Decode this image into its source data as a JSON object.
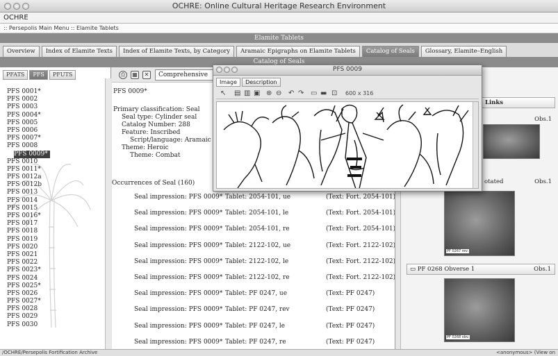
{
  "window": {
    "title": "OCHRE: Online Cultural Heritage Research Environment"
  },
  "menubar": {
    "label": "OCHRE"
  },
  "breadcrumb": ":: Persepolis Main Menu :: Elamite Tablets",
  "bands": {
    "section": "Elamite Tablets",
    "subsection": "Catalog of Seals"
  },
  "tabs": [
    {
      "label": "Overview"
    },
    {
      "label": "Index of Elamite Texts"
    },
    {
      "label": "Index of Elamite Texts, by Category"
    },
    {
      "label": "Aramaic Epigraphs on Elamite Tablets"
    },
    {
      "label": "Catalog of Seals"
    },
    {
      "label": "Glossary, Elamite–English"
    }
  ],
  "subtabs": [
    {
      "label": "PFATS"
    },
    {
      "label": "PFS"
    },
    {
      "label": "PFUTS"
    }
  ],
  "seals": [
    "PFS 0001*",
    "PFS 0002",
    "PFS 0003",
    "PFS 0004*",
    "PFS 0005",
    "PFS 0006",
    "PFS 0007*",
    "PFS 0008",
    "PFS 0009*",
    "PFS 0010",
    "PFS 0011*",
    "PFS 0012a",
    "PFS 0012b",
    "PFS 0013",
    "PFS 0014",
    "PFS 0015",
    "PFS 0016*",
    "PFS 0017",
    "PFS 0018",
    "PFS 0019",
    "PFS 0020",
    "PFS 0021",
    "PFS 0022",
    "PFS 0023*",
    "PFS 0024",
    "PFS 0025*",
    "PFS 0026",
    "PFS 0027*",
    "PFS 0028",
    "PFS 0029",
    "PFS 0030"
  ],
  "selected_seal_index": 8,
  "toolbar": {
    "view_select": "Comprehensive"
  },
  "detail": {
    "title": "PFS 0009*",
    "primary": "Primary classification:  Seal",
    "seal_type": "Seal type:  Cylinder seal",
    "catalog_number": "Catalog Number:  288",
    "feature": "Feature:  Inscribed",
    "script": "Script/language:  Aramaic",
    "theme": "Theme:  Heroic",
    "theme2": "Theme:  Combat",
    "occurrences": "Occurrences of Seal (160)"
  },
  "occurrences": [
    {
      "impression": "Seal impression:  PFS 0009*",
      "tablet": "Tablet:  2054-101, ue",
      "text": "(Text: Fort. 2054-101)"
    },
    {
      "impression": "Seal impression:  PFS 0009*",
      "tablet": "Tablet:  2054-101, le",
      "text": "(Text: Fort. 2054-101)"
    },
    {
      "impression": "Seal impression:  PFS 0009*",
      "tablet": "Tablet:  2054-101, re",
      "text": "(Text: Fort. 2054-101)"
    },
    {
      "impression": "Seal impression:  PFS 0009*",
      "tablet": "Tablet:  2122-102, ue",
      "text": "(Text: Fort. 2122-102)"
    },
    {
      "impression": "Seal impression:  PFS 0009*",
      "tablet": "Tablet:  2122-102, le",
      "text": "(Text: Fort. 2122-102)"
    },
    {
      "impression": "Seal impression:  PFS 0009*",
      "tablet": "Tablet:  2122-102, re",
      "text": "(Text: Fort. 2122-102)"
    },
    {
      "impression": "Seal impression:  PFS 0009*",
      "tablet": "Tablet:  PF 0247, ue",
      "text": "(Text: PF 0247)"
    },
    {
      "impression": "Seal impression:  PFS 0009*",
      "tablet": "Tablet:  PF 0247, rev",
      "text": "(Text: PF 0247)"
    },
    {
      "impression": "Seal impression:  PFS 0009*",
      "tablet": "Tablet:  PF 0247, le",
      "text": "(Text: PF 0247)"
    },
    {
      "impression": "Seal impression:  PFS 0009*",
      "tablet": "Tablet:  PF 0247, re",
      "text": "(Text: PF 0247)"
    }
  ],
  "right": {
    "links_title": "Links",
    "item1_obs": "Obs.1",
    "item2_title": "otated",
    "item2_obs": "Obs.1",
    "item3_title": "PF 0268 Obverse 1",
    "item3_obs": "Obs.1",
    "thumb2_caption": "PF 0267 rev.",
    "thumb3_caption": "PF 0268 obv."
  },
  "popup": {
    "title": "PFS 0009",
    "tabs": [
      {
        "label": "Image"
      },
      {
        "label": "Description"
      }
    ],
    "size_label": "600 x 316"
  },
  "status": {
    "path": "/OCHRE/Persepolis Fortification Archive",
    "user": "<anonymous>  (View on"
  }
}
